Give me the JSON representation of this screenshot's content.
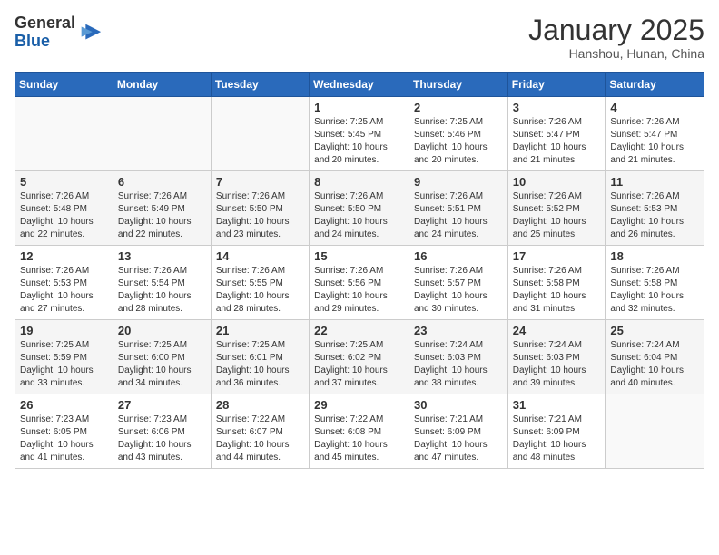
{
  "logo": {
    "general": "General",
    "blue": "Blue"
  },
  "title": "January 2025",
  "subtitle": "Hanshou, Hunan, China",
  "weekdays": [
    "Sunday",
    "Monday",
    "Tuesday",
    "Wednesday",
    "Thursday",
    "Friday",
    "Saturday"
  ],
  "weeks": [
    [
      {
        "day": "",
        "sunrise": "",
        "sunset": "",
        "daylight": ""
      },
      {
        "day": "",
        "sunrise": "",
        "sunset": "",
        "daylight": ""
      },
      {
        "day": "",
        "sunrise": "",
        "sunset": "",
        "daylight": ""
      },
      {
        "day": "1",
        "sunrise": "Sunrise: 7:25 AM",
        "sunset": "Sunset: 5:45 PM",
        "daylight": "Daylight: 10 hours and 20 minutes."
      },
      {
        "day": "2",
        "sunrise": "Sunrise: 7:25 AM",
        "sunset": "Sunset: 5:46 PM",
        "daylight": "Daylight: 10 hours and 20 minutes."
      },
      {
        "day": "3",
        "sunrise": "Sunrise: 7:26 AM",
        "sunset": "Sunset: 5:47 PM",
        "daylight": "Daylight: 10 hours and 21 minutes."
      },
      {
        "day": "4",
        "sunrise": "Sunrise: 7:26 AM",
        "sunset": "Sunset: 5:47 PM",
        "daylight": "Daylight: 10 hours and 21 minutes."
      }
    ],
    [
      {
        "day": "5",
        "sunrise": "Sunrise: 7:26 AM",
        "sunset": "Sunset: 5:48 PM",
        "daylight": "Daylight: 10 hours and 22 minutes."
      },
      {
        "day": "6",
        "sunrise": "Sunrise: 7:26 AM",
        "sunset": "Sunset: 5:49 PM",
        "daylight": "Daylight: 10 hours and 22 minutes."
      },
      {
        "day": "7",
        "sunrise": "Sunrise: 7:26 AM",
        "sunset": "Sunset: 5:50 PM",
        "daylight": "Daylight: 10 hours and 23 minutes."
      },
      {
        "day": "8",
        "sunrise": "Sunrise: 7:26 AM",
        "sunset": "Sunset: 5:50 PM",
        "daylight": "Daylight: 10 hours and 24 minutes."
      },
      {
        "day": "9",
        "sunrise": "Sunrise: 7:26 AM",
        "sunset": "Sunset: 5:51 PM",
        "daylight": "Daylight: 10 hours and 24 minutes."
      },
      {
        "day": "10",
        "sunrise": "Sunrise: 7:26 AM",
        "sunset": "Sunset: 5:52 PM",
        "daylight": "Daylight: 10 hours and 25 minutes."
      },
      {
        "day": "11",
        "sunrise": "Sunrise: 7:26 AM",
        "sunset": "Sunset: 5:53 PM",
        "daylight": "Daylight: 10 hours and 26 minutes."
      }
    ],
    [
      {
        "day": "12",
        "sunrise": "Sunrise: 7:26 AM",
        "sunset": "Sunset: 5:53 PM",
        "daylight": "Daylight: 10 hours and 27 minutes."
      },
      {
        "day": "13",
        "sunrise": "Sunrise: 7:26 AM",
        "sunset": "Sunset: 5:54 PM",
        "daylight": "Daylight: 10 hours and 28 minutes."
      },
      {
        "day": "14",
        "sunrise": "Sunrise: 7:26 AM",
        "sunset": "Sunset: 5:55 PM",
        "daylight": "Daylight: 10 hours and 28 minutes."
      },
      {
        "day": "15",
        "sunrise": "Sunrise: 7:26 AM",
        "sunset": "Sunset: 5:56 PM",
        "daylight": "Daylight: 10 hours and 29 minutes."
      },
      {
        "day": "16",
        "sunrise": "Sunrise: 7:26 AM",
        "sunset": "Sunset: 5:57 PM",
        "daylight": "Daylight: 10 hours and 30 minutes."
      },
      {
        "day": "17",
        "sunrise": "Sunrise: 7:26 AM",
        "sunset": "Sunset: 5:58 PM",
        "daylight": "Daylight: 10 hours and 31 minutes."
      },
      {
        "day": "18",
        "sunrise": "Sunrise: 7:26 AM",
        "sunset": "Sunset: 5:58 PM",
        "daylight": "Daylight: 10 hours and 32 minutes."
      }
    ],
    [
      {
        "day": "19",
        "sunrise": "Sunrise: 7:25 AM",
        "sunset": "Sunset: 5:59 PM",
        "daylight": "Daylight: 10 hours and 33 minutes."
      },
      {
        "day": "20",
        "sunrise": "Sunrise: 7:25 AM",
        "sunset": "Sunset: 6:00 PM",
        "daylight": "Daylight: 10 hours and 34 minutes."
      },
      {
        "day": "21",
        "sunrise": "Sunrise: 7:25 AM",
        "sunset": "Sunset: 6:01 PM",
        "daylight": "Daylight: 10 hours and 36 minutes."
      },
      {
        "day": "22",
        "sunrise": "Sunrise: 7:25 AM",
        "sunset": "Sunset: 6:02 PM",
        "daylight": "Daylight: 10 hours and 37 minutes."
      },
      {
        "day": "23",
        "sunrise": "Sunrise: 7:24 AM",
        "sunset": "Sunset: 6:03 PM",
        "daylight": "Daylight: 10 hours and 38 minutes."
      },
      {
        "day": "24",
        "sunrise": "Sunrise: 7:24 AM",
        "sunset": "Sunset: 6:03 PM",
        "daylight": "Daylight: 10 hours and 39 minutes."
      },
      {
        "day": "25",
        "sunrise": "Sunrise: 7:24 AM",
        "sunset": "Sunset: 6:04 PM",
        "daylight": "Daylight: 10 hours and 40 minutes."
      }
    ],
    [
      {
        "day": "26",
        "sunrise": "Sunrise: 7:23 AM",
        "sunset": "Sunset: 6:05 PM",
        "daylight": "Daylight: 10 hours and 41 minutes."
      },
      {
        "day": "27",
        "sunrise": "Sunrise: 7:23 AM",
        "sunset": "Sunset: 6:06 PM",
        "daylight": "Daylight: 10 hours and 43 minutes."
      },
      {
        "day": "28",
        "sunrise": "Sunrise: 7:22 AM",
        "sunset": "Sunset: 6:07 PM",
        "daylight": "Daylight: 10 hours and 44 minutes."
      },
      {
        "day": "29",
        "sunrise": "Sunrise: 7:22 AM",
        "sunset": "Sunset: 6:08 PM",
        "daylight": "Daylight: 10 hours and 45 minutes."
      },
      {
        "day": "30",
        "sunrise": "Sunrise: 7:21 AM",
        "sunset": "Sunset: 6:09 PM",
        "daylight": "Daylight: 10 hours and 47 minutes."
      },
      {
        "day": "31",
        "sunrise": "Sunrise: 7:21 AM",
        "sunset": "Sunset: 6:09 PM",
        "daylight": "Daylight: 10 hours and 48 minutes."
      },
      {
        "day": "",
        "sunrise": "",
        "sunset": "",
        "daylight": ""
      }
    ]
  ]
}
